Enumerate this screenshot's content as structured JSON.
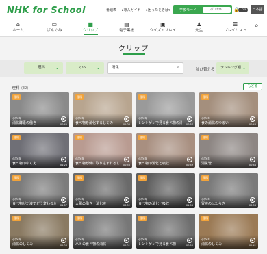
{
  "header": {
    "logo": "NHK for School",
    "top_links": [
      "番組表",
      "▸導入ガイド",
      "▸困ったときは▾"
    ],
    "mode_on": "学校モード",
    "mode_off": "ｽｸﾞﾚｾｯﾄﾞ",
    "toggle_label": "OFF",
    "lang_label": "日本語"
  },
  "nav": [
    {
      "icon": "home-icon",
      "glyph": "⌂",
      "label": "ホーム"
    },
    {
      "icon": "tv-icon",
      "glyph": "▭",
      "label": "ばんぐみ"
    },
    {
      "icon": "clip-icon",
      "glyph": "■",
      "label": "クリップ"
    },
    {
      "icon": "ebook-icon",
      "glyph": "▤",
      "label": "電子黒板"
    },
    {
      "icon": "quiz-icon",
      "glyph": "▣",
      "label": "クイズ・プレイ"
    },
    {
      "icon": "teacher-icon",
      "glyph": "♟",
      "label": "先生"
    },
    {
      "icon": "playlist-icon",
      "glyph": "☰",
      "label": "プレイリスト"
    }
  ],
  "page_title": "クリップ",
  "filters": {
    "subject": "理科",
    "grade": "小6",
    "keyword": "消化",
    "sort_label": "並び替える",
    "sort_value": "ランキング順"
  },
  "result": {
    "subject": "理科",
    "count": "(32)",
    "back_label": "もどる"
  },
  "colors": {
    "accent": "#2e9e4a",
    "select_bg": "#d9ecc8",
    "badge": "#f2a33a"
  },
  "cards": [
    {
      "badge": "理科",
      "grade": "小学6年",
      "title": "消化酵素の働き",
      "duration": "00:42",
      "tone": "#8a8a8a"
    },
    {
      "badge": "理科",
      "grade": "小学6年",
      "title": "食べ物を消化するしくみ",
      "duration": "01:06",
      "tone": "#b8a58f"
    },
    {
      "badge": "理科",
      "grade": "小学6年",
      "title": "レントゲンで見る食べ物の消…",
      "duration": "00:57",
      "tone": "#9a9a9a"
    },
    {
      "badge": "理科",
      "grade": "小学6年",
      "title": "食の消化のゆるい",
      "duration": "00:46",
      "tone": "#a48f7d"
    },
    {
      "badge": "理科",
      "grade": "小学6年",
      "title": "食べ物のゆくえ",
      "duration": "01:26",
      "tone": "#6f6f76"
    },
    {
      "badge": "理科",
      "grade": "小学6年",
      "title": "食べ物が体に取り込まれるしくみ",
      "duration": "00:56",
      "tone": "#b99b91"
    },
    {
      "badge": "理科",
      "grade": "小学6年",
      "title": "食べ物の消化と吸収",
      "duration": "00:49",
      "tone": "#a88f80"
    },
    {
      "badge": "理科",
      "grade": "小学6年",
      "title": "消化管",
      "duration": "00:44",
      "tone": "#8d8683"
    },
    {
      "badge": "理科",
      "grade": "小学6年",
      "title": "食べ物がだ液でどう変わるか",
      "duration": "01:07",
      "tone": "#7c7c7c"
    },
    {
      "badge": "理科",
      "grade": "小学6年",
      "title": "大腸の働き・消化液",
      "duration": "00:52",
      "tone": "#6a6a6a"
    },
    {
      "badge": "理科",
      "grade": "小学6年",
      "title": "食べ物の消化と吸収",
      "duration": "01:06",
      "tone": "#5e5e5e"
    },
    {
      "badge": "理科",
      "grade": "小学6年",
      "title": "胃液のはたらき",
      "duration": "00:58",
      "tone": "#7a7a7a"
    },
    {
      "badge": "理科",
      "grade": "小学6年",
      "title": "消化のしくみ",
      "duration": "01:26",
      "tone": "#8a7a62"
    },
    {
      "badge": "理科",
      "grade": "小学6年",
      "title": "ハトの食べ物の消化",
      "duration": "01:21",
      "tone": "#777777"
    },
    {
      "badge": "理科",
      "grade": "小学6年",
      "title": "レントゲンで見る食べ物",
      "duration": "00:54",
      "tone": "#6e6e6e"
    },
    {
      "badge": "理科",
      "grade": "小学6年",
      "title": "消化のしくみ",
      "duration": "01:41",
      "tone": "#9b7a55"
    }
  ]
}
